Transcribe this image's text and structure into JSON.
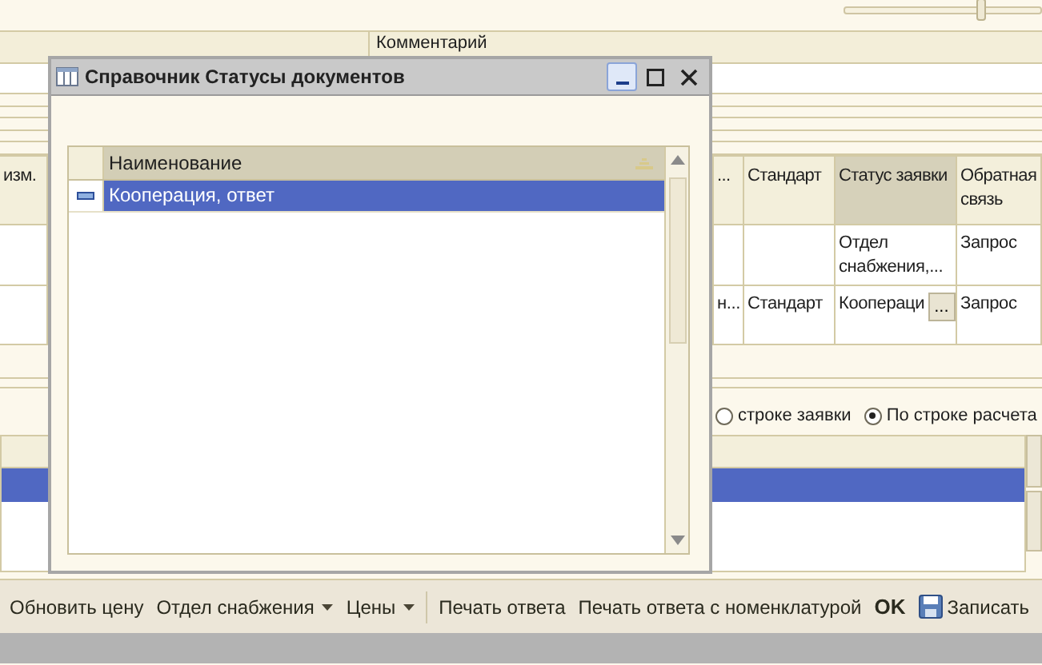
{
  "zoom_slider": {
    "level": 0.69
  },
  "comment_label": "Комментарий",
  "table": {
    "columns": [
      {
        "label": "изм.",
        "selected": false
      },
      {
        "label": "...",
        "selected": false
      },
      {
        "label": "Стандарт",
        "selected": false
      },
      {
        "label": "Статус заявки",
        "selected": true
      },
      {
        "label": "Обратная связь",
        "selected": false
      }
    ],
    "rows": [
      {
        "cells": [
          {
            "text": ""
          },
          {
            "text": ""
          },
          {
            "text": ""
          },
          {
            "text": "Отдел снабжения,..."
          },
          {
            "text": "Запрос"
          }
        ]
      },
      {
        "cells": [
          {
            "text": ""
          },
          {
            "text": "н..."
          },
          {
            "text": "Стандарт"
          },
          {
            "text": "Коопераци",
            "button": "..."
          },
          {
            "text": "Запрос"
          }
        ]
      }
    ]
  },
  "calc_mode": [
    {
      "label": "строке заявки",
      "selected": false
    },
    {
      "label": "По строке расчета",
      "selected": true
    }
  ],
  "lower_table": {
    "rows": [
      {
        "selected": true
      },
      {
        "selected": false
      }
    ]
  },
  "toolbar": [
    {
      "kind": "button",
      "label": "Обновить цену"
    },
    {
      "kind": "menu",
      "label": "Отдел снабжения"
    },
    {
      "kind": "menu",
      "label": "Цены"
    },
    {
      "kind": "separator"
    },
    {
      "kind": "button",
      "label": "Печать ответа"
    },
    {
      "kind": "button",
      "label": "Печать ответа с номенклатурой"
    },
    {
      "kind": "default",
      "label": "OK"
    },
    {
      "kind": "save",
      "label": "Записать"
    }
  ],
  "dialog": {
    "title": "Справочник Статусы документов",
    "column": "Наименование",
    "rows": [
      {
        "text": "Кооперация, ответ",
        "selected": true
      }
    ]
  }
}
